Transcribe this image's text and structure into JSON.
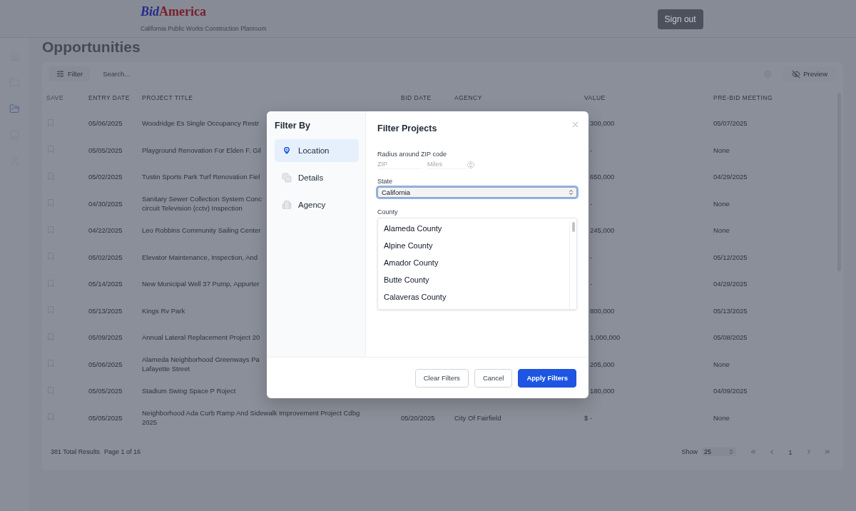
{
  "header": {
    "logo": [
      "Bid",
      "America"
    ],
    "tagline": "California Public Works Construction Planroom",
    "sign_out": "Sign out"
  },
  "sidebar": {
    "items": [
      {
        "kind": "home",
        "selected": false
      },
      {
        "kind": "folder",
        "selected": false
      },
      {
        "kind": "folder-open",
        "selected": true
      },
      {
        "kind": "book",
        "selected": false
      },
      {
        "kind": "user",
        "selected": false
      }
    ]
  },
  "page_title": "Opportunities",
  "toolbar": {
    "filter": "Filter",
    "search_placeholder": "Search...",
    "preview": "Preview"
  },
  "table": {
    "columns": [
      "SAVE",
      "ENTRY DATE",
      "PROJECT TITLE",
      "BID DATE",
      "AGENCY",
      "VALUE",
      "PRE-BID MEETING"
    ],
    "rows": [
      {
        "entry_date": "05/06/2025",
        "title_lines": [
          "Woodridge Es Single Occupancy Restr"
        ],
        "value": "300,000",
        "pre_bid_meeting": "05/07/2025"
      },
      {
        "entry_date": "05/05/2025",
        "title_lines": [
          "Playground Renovation For Elden F. Gil"
        ],
        "value": "-",
        "pre_bid_meeting": "None"
      },
      {
        "entry_date": "05/02/2025",
        "title_lines": [
          "Tustin Sports Park Turf Renovation Fiel"
        ],
        "value": "650,000",
        "pre_bid_meeting": "04/29/2025"
      },
      {
        "entry_date": "04/30/2025",
        "title_lines": [
          "Sanitary Sewer Collection System Conc",
          "circuit Television (cctv) Inspection"
        ],
        "value": "-",
        "pre_bid_meeting": "None"
      },
      {
        "entry_date": "04/22/2025",
        "title_lines": [
          "Leo Robbins Community Sailing Center"
        ],
        "value": "245,000",
        "pre_bid_meeting": "None"
      },
      {
        "entry_date": "05/02/2025",
        "title_lines": [
          "Elevator Maintenance, Inspection, And"
        ],
        "value": "-",
        "pre_bid_meeting": "05/12/2025"
      },
      {
        "entry_date": "05/14/2025",
        "title_lines": [
          "New Municipal Well 37 Pump, Appurter"
        ],
        "value": "-",
        "pre_bid_meeting": "04/29/2025"
      },
      {
        "entry_date": "05/13/2025",
        "title_lines": [
          "Kings Rv Park"
        ],
        "value": "800,000",
        "pre_bid_meeting": "05/13/2025"
      },
      {
        "entry_date": "05/09/2025",
        "title_lines": [
          "Annual Lateral Replacement Project 20"
        ],
        "value": "1,000,000",
        "pre_bid_meeting": "05/08/2025"
      },
      {
        "entry_date": "05/06/2025",
        "title_lines": [
          "Alameda Neighborhood Greenways Pa",
          "Lafayette Street"
        ],
        "value": "205,000",
        "pre_bid_meeting": "None"
      },
      {
        "entry_date": "05/05/2025",
        "title_lines": [
          "Stadium Swing Space P Roject"
        ],
        "value": "180,000",
        "pre_bid_meeting": "04/09/2025"
      },
      {
        "entry_date": "05/05/2025",
        "title_lines": [
          "Neighborhood Ada Curb Ramp And Sidewalk Improvement Project Cdbg",
          "2025"
        ],
        "bid_date": "05/20/2025",
        "agency": "City Of Fairfield",
        "value": "$ -",
        "pre_bid_meeting": "None"
      }
    ]
  },
  "footer": {
    "total": "381 Total Results",
    "page": "Page 1 of 16",
    "show_label": "Show",
    "page_size": "25",
    "pager": [
      {
        "kind": "first"
      },
      {
        "kind": "prev"
      },
      {
        "kind": "page",
        "label": "1"
      },
      {
        "kind": "next"
      },
      {
        "kind": "last"
      }
    ]
  },
  "modal": {
    "nav_title": "Filter By",
    "nav": [
      {
        "label": "Location",
        "kind": "location",
        "selected": true
      },
      {
        "label": "Details",
        "kind": "details",
        "selected": false
      },
      {
        "label": "Agency",
        "kind": "agency",
        "selected": false
      }
    ],
    "title": "Filter Projects",
    "radius_label": "Radius around ZIP code",
    "zip_placeholder": "ZIP",
    "miles_placeholder": "Miles",
    "state_label": "State",
    "state_value": "California",
    "state_focused": true,
    "county_label": "County",
    "counties": [
      "Alameda County",
      "Alpine County",
      "Amador County",
      "Butte County",
      "Calaveras County"
    ],
    "buttons": [
      {
        "label": "Clear Filters",
        "kind": "secondary"
      },
      {
        "label": "Cancel",
        "kind": "secondary"
      },
      {
        "label": "Apply Filters",
        "kind": "primary"
      }
    ]
  }
}
